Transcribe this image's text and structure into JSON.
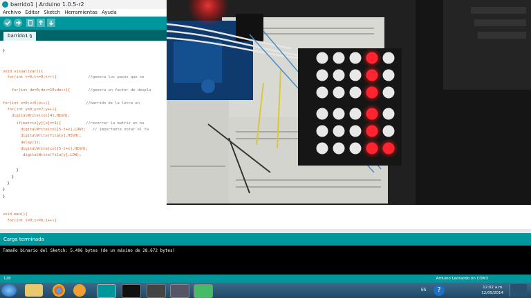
{
  "window": {
    "title": "barrido1 | Arduino 1.0.5-r2"
  },
  "menu": [
    "Archivo",
    "Editar",
    "Sketch",
    "Herramientas",
    "Ayuda"
  ],
  "toolbar": {
    "icons": [
      "verify-icon",
      "upload-icon",
      "new-icon",
      "open-icon",
      "save-icon"
    ]
  },
  "tab": {
    "label": "barrido1 §"
  },
  "code": [
    {
      "text": "}",
      "kind": "plain"
    },
    {
      "text": "void visualizar(){",
      "kind": "plain"
    },
    {
      "text": "  for(int t=0;t<=9;t++){              //genera los pasos que se",
      "kind": "mixed"
    },
    {
      "text": "    for(int de=0;de<=10;de++){        //genera un factor de despla",
      "kind": "mixed"
    },
    {
      "text": "for(int x=0;x<5;x++){                //barrido de la letra en",
      "kind": "mixed"
    },
    {
      "text": "  for(int y=0;y<=7;y++){",
      "kind": "plain"
    },
    {
      "text": "    digitalWrite(col[4],HIGH);",
      "kind": "plain"
    },
    {
      "text": "      if(matriz[y][x]==1){           //recorrer la matriz en bu",
      "kind": "mixed"
    },
    {
      "text": "        digitalWrite(col[5-t+x],LOW);   // importante notar el fa",
      "kind": "mixed"
    },
    {
      "text": "        digitalWrite(fila[y],HIGH);",
      "kind": "plain"
    },
    {
      "text": "        delay(1);",
      "kind": "plain"
    },
    {
      "text": "        digitalWrite(col[5-t+x],HIGH);",
      "kind": "plain"
    },
    {
      "text": "         digitalWrite(fila[y],LOW);",
      "kind": "plain"
    },
    {
      "text": "      }",
      "kind": "plain"
    },
    {
      "text": "    }",
      "kind": "plain"
    },
    {
      "text": "  }",
      "kind": "plain"
    },
    {
      "text": "}",
      "kind": "plain"
    },
    {
      "text": "}",
      "kind": "plain"
    },
    {
      "text": "void man(){",
      "kind": "plain"
    },
    {
      "text": "  for(int i=0;i<=6;i++){",
      "kind": "plain"
    }
  ],
  "status": {
    "message": "Carga terminada"
  },
  "console": {
    "line": "Tamaño binario del Sketch: 5.496 bytes (de un máximo de 28.672 bytes)"
  },
  "footer": {
    "line_number": "128",
    "board": "Arduino Leonardo on COM3"
  },
  "taskbar": {
    "language": "ES",
    "time": "12:02 a.m.",
    "date": "12/05/2014",
    "apps": [
      "start-button",
      "explorer-icon",
      "chrome-icon",
      "media-player-icon",
      "arduino-icon",
      "terminal-icon",
      "pen-app-icon",
      "fritzing-icon",
      "chip-app-icon"
    ]
  },
  "photo": {
    "led_matrix": {
      "rows": 6,
      "cols": 5,
      "lit": [
        [
          0,
          0,
          0,
          1,
          0
        ],
        [
          0,
          0,
          0,
          1,
          0
        ],
        [
          0,
          0,
          0,
          1,
          0
        ],
        [
          0,
          0,
          0,
          1,
          0
        ],
        [
          0,
          0,
          0,
          1,
          0
        ],
        [
          0,
          0,
          0,
          1,
          1
        ]
      ],
      "lit_color": "#ff2430",
      "off_color": "#e8e8e8"
    }
  },
  "colors": {
    "arduino_teal": "#00979c",
    "arduino_dark_teal": "#006468"
  }
}
